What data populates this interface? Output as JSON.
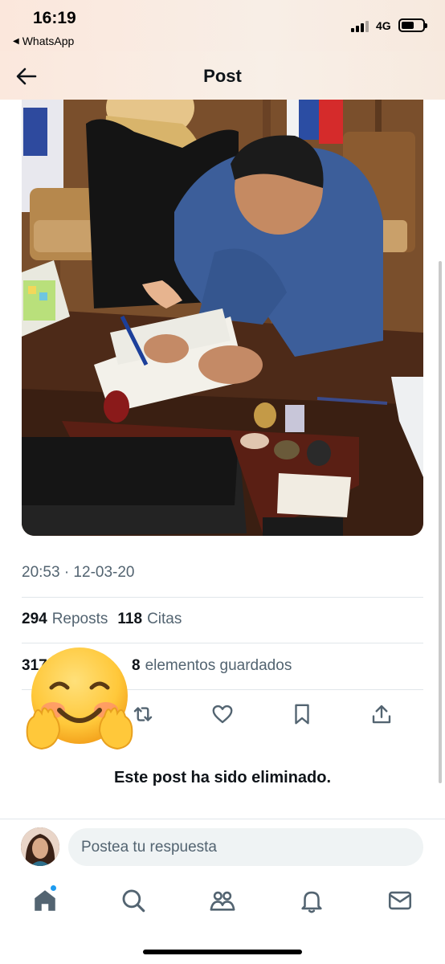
{
  "status_bar": {
    "time": "16:19",
    "back_app": "WhatsApp",
    "network": "4G"
  },
  "header": {
    "title": "Post"
  },
  "post": {
    "timestamp": "20:53 · 12-03-20",
    "reposts_count": "294",
    "reposts_label": "Reposts",
    "quotes_count": "118",
    "quotes_label": "Citas",
    "likes_count_partial": "317",
    "likes_label_partial": "a",
    "bookmarks_count": "8",
    "bookmarks_label": "elementos guardados",
    "deleted_message": "Este post ha sido eliminado."
  },
  "reply": {
    "placeholder": "Postea tu respuesta"
  },
  "colors": {
    "accent": "#1d9bf0",
    "secondary_text": "#536471",
    "primary_text": "#0f1419"
  },
  "icons": {
    "actions": [
      "reply-icon",
      "repost-icon",
      "like-icon",
      "bookmark-icon",
      "share-icon"
    ],
    "tabs": [
      "home-icon",
      "search-icon",
      "communities-icon",
      "notifications-icon",
      "messages-icon"
    ],
    "overlay": "smiling-face-with-hands-emoji"
  }
}
